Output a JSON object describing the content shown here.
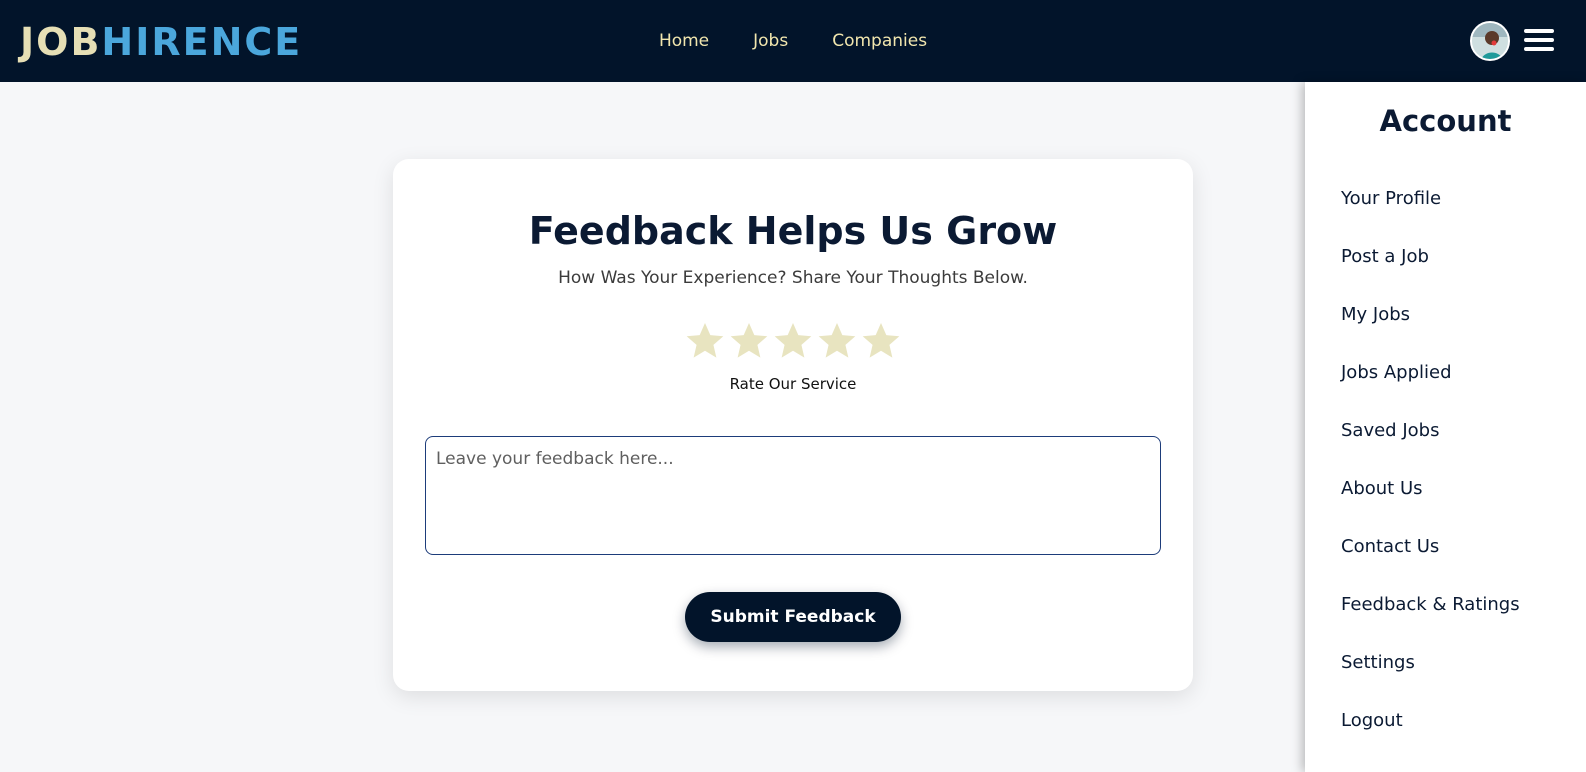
{
  "header": {
    "logo_part_a": "JOB",
    "logo_part_b": "HIRENCE",
    "nav": [
      "Home",
      "Jobs",
      "Companies"
    ]
  },
  "feedback": {
    "title": "Feedback Helps Us Grow",
    "subtitle": "How Was Your Experience? Share Your Thoughts Below.",
    "rating": {
      "max_stars": 5,
      "selected": 0,
      "label": "Rate Our Service"
    },
    "textarea_placeholder": "Leave your feedback here...",
    "submit_label": "Submit Feedback"
  },
  "account_menu": {
    "title": "Account",
    "items": [
      "Your Profile",
      "Post a Job",
      "My Jobs",
      "Jobs Applied",
      "Saved Jobs",
      "About Us",
      "Contact Us",
      "Feedback & Ratings",
      "Settings",
      "Logout"
    ]
  },
  "colors": {
    "navbar": "#02142a",
    "logo_accent_a": "#e6dfb5",
    "logo_accent_b": "#4ba7dc",
    "nav_link": "#f1e6ae",
    "star_empty": "#e8e4c0",
    "button": "#02142a"
  },
  "icons": {
    "avatar": "user-avatar",
    "menu": "hamburger-icon",
    "star": "star-icon"
  }
}
